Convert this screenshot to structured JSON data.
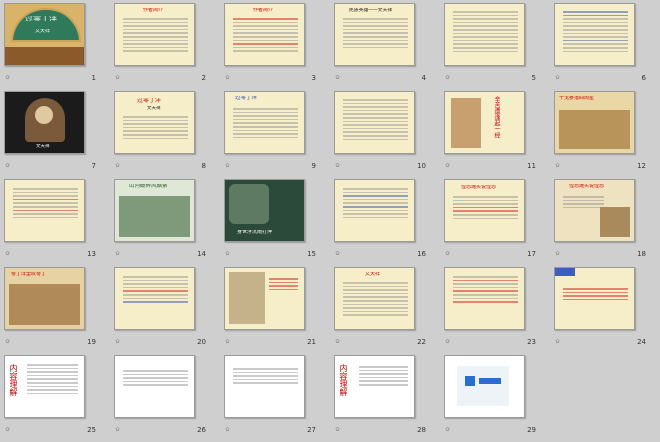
{
  "slides": [
    {
      "n": "1",
      "title": "过零丁洋",
      "subtitle": "文天祥"
    },
    {
      "n": "2",
      "title": "作者简介"
    },
    {
      "n": "3",
      "title": "作者简介"
    },
    {
      "n": "4",
      "title": "民族英雄——文天祥"
    },
    {
      "n": "5"
    },
    {
      "n": "6"
    },
    {
      "n": "7",
      "caption": "文天祥"
    },
    {
      "n": "8",
      "title": "过零丁洋",
      "subtitle": "文天祥"
    },
    {
      "n": "9",
      "title": "过零丁洋"
    },
    {
      "n": "10"
    },
    {
      "n": "11",
      "title": "辛苦遭逢起一经"
    },
    {
      "n": "12",
      "title": "干戈寥落四周星"
    },
    {
      "n": "13"
    },
    {
      "n": "14",
      "title": "山河破碎风飘絮"
    },
    {
      "n": "15",
      "title": "身世浮沉雨打萍"
    },
    {
      "n": "16"
    },
    {
      "n": "17",
      "title": "惶恐滩头说惶恐"
    },
    {
      "n": "18",
      "title": "惶恐滩头说惶恐"
    },
    {
      "n": "19",
      "title": "零丁洋里叹零丁"
    },
    {
      "n": "20"
    },
    {
      "n": "21"
    },
    {
      "n": "22",
      "title": "文天祥"
    },
    {
      "n": "23"
    },
    {
      "n": "24"
    },
    {
      "n": "25",
      "title": "内容理解"
    },
    {
      "n": "26"
    },
    {
      "n": "27"
    },
    {
      "n": "28",
      "title": "内容理解"
    },
    {
      "n": "29"
    }
  ],
  "colors": {
    "bg": "#cfcfcf",
    "parchment": "#f6eec8",
    "accent": "#c00000",
    "blue": "#1a3fb0"
  }
}
